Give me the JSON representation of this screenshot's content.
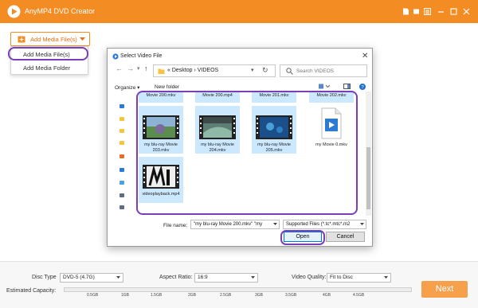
{
  "app": {
    "title": "AnyMP4 DVD Creator",
    "accent_color": "#f48c24",
    "titlebar_icons": [
      "file-icon",
      "cart-icon",
      "menu-icon",
      "minimize-icon",
      "maximize-icon",
      "close-icon"
    ]
  },
  "add_media": {
    "button_label": "Add Media File(s)",
    "menu_items": [
      "Add Media File(s)",
      "Add Media Folder"
    ]
  },
  "dialog": {
    "title": "Select Video File",
    "close_glyph": "✕",
    "address_path": "« Desktop  ›  VIDEOS",
    "search_placeholder": "Search VIDEOS",
    "toolbar": {
      "organize_label": "Organize ▾",
      "new_folder_label": "New folder"
    },
    "files_top_row": [
      "Movie 200.mkv",
      "Movie 200.mp4",
      "Movie 201.mkv",
      "Movie 202.mkv"
    ],
    "files": [
      {
        "name": "my blu-ray Movie 203.mkv",
        "thumb": "video"
      },
      {
        "name": "my blu-ray Movie 204.mkv",
        "thumb": "video"
      },
      {
        "name": "my blu-ray Movie 205.mkv",
        "thumb": "video"
      },
      {
        "name": "my Movie 0.mkv",
        "thumb": "doc"
      },
      {
        "name": "videoplayback.mp4",
        "thumb": "bw"
      }
    ],
    "file_name_label": "File name:",
    "file_name_value": "\"my blu-ray Movie 200.mkv\" \"my",
    "file_type_value": "Supported Files (*.tc*.mtc*.m2",
    "open_label": "Open",
    "cancel_label": "Cancel"
  },
  "footer": {
    "disc_type_label": "Disc Type",
    "disc_type_value": "DVD-5 (4.7G)",
    "aspect_label": "Aspect Ratio:",
    "aspect_value": "16:9",
    "quality_label": "Video Quality:",
    "quality_value": "Fit to Disc",
    "capacity_label": "Estimated Capacity:",
    "capacity_ticks": [
      "0.5GB",
      "1GB",
      "1.5GB",
      "2GB",
      "2.5GB",
      "3GB",
      "3.5GB",
      "4GB",
      "4.5GB"
    ],
    "next_label": "Next"
  },
  "highlight_color": "#7a3fb8"
}
